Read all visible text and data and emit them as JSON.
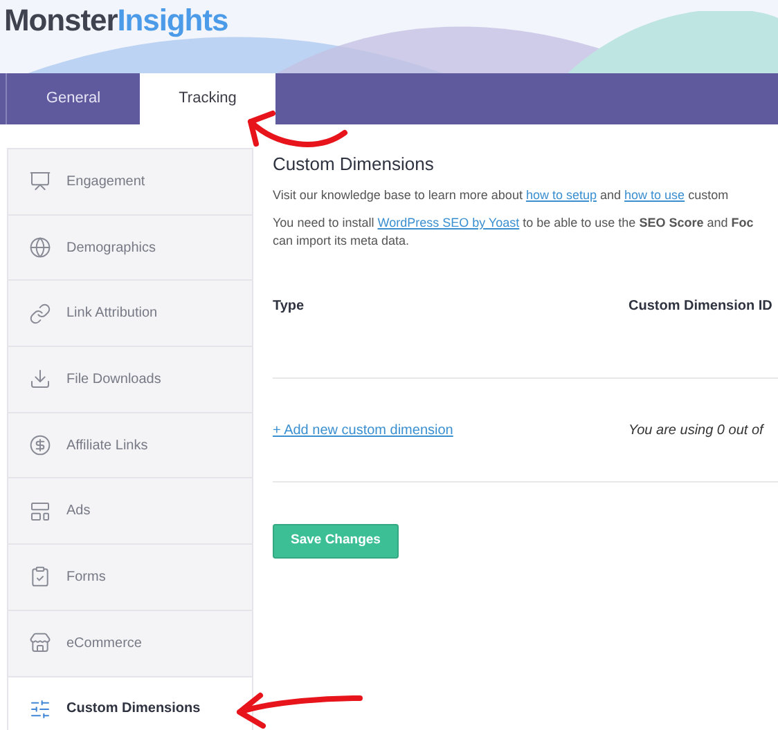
{
  "logo": {
    "part1": "Monster",
    "part2": "Insights"
  },
  "tabs": [
    {
      "label": "General",
      "selected": false
    },
    {
      "label": "Tracking",
      "selected": true
    }
  ],
  "sidebar": {
    "items": [
      {
        "label": "Engagement",
        "selected": false
      },
      {
        "label": "Demographics",
        "selected": false
      },
      {
        "label": "Link Attribution",
        "selected": false
      },
      {
        "label": "File Downloads",
        "selected": false
      },
      {
        "label": "Affiliate Links",
        "selected": false
      },
      {
        "label": "Ads",
        "selected": false
      },
      {
        "label": "Forms",
        "selected": false
      },
      {
        "label": "eCommerce",
        "selected": false
      },
      {
        "label": "Custom Dimensions",
        "selected": true
      }
    ]
  },
  "content": {
    "title": "Custom Dimensions",
    "paragraphs": [
      [
        {
          "kind": "text",
          "text": "Visit our knowledge base to learn more about "
        },
        {
          "kind": "link",
          "text": "how to setup"
        },
        {
          "kind": "text",
          "text": " and "
        },
        {
          "kind": "link",
          "text": "how to use"
        },
        {
          "kind": "text",
          "text": " custom"
        }
      ],
      [
        {
          "kind": "text",
          "text": "You need to install "
        },
        {
          "kind": "link",
          "text": "WordPress SEO by Yoast"
        },
        {
          "kind": "text",
          "text": " to be able to use the **SEO Score** and **Foc**"
        },
        {
          "kind": "break"
        },
        {
          "kind": "text",
          "text": "can import its meta data."
        }
      ]
    ],
    "table": {
      "columns": [
        "Type",
        "Custom Dimension ID"
      ],
      "add_link": "+ Add new custom dimension",
      "usage": "You are using 0 out of"
    },
    "save_button": "Save Changes"
  }
}
